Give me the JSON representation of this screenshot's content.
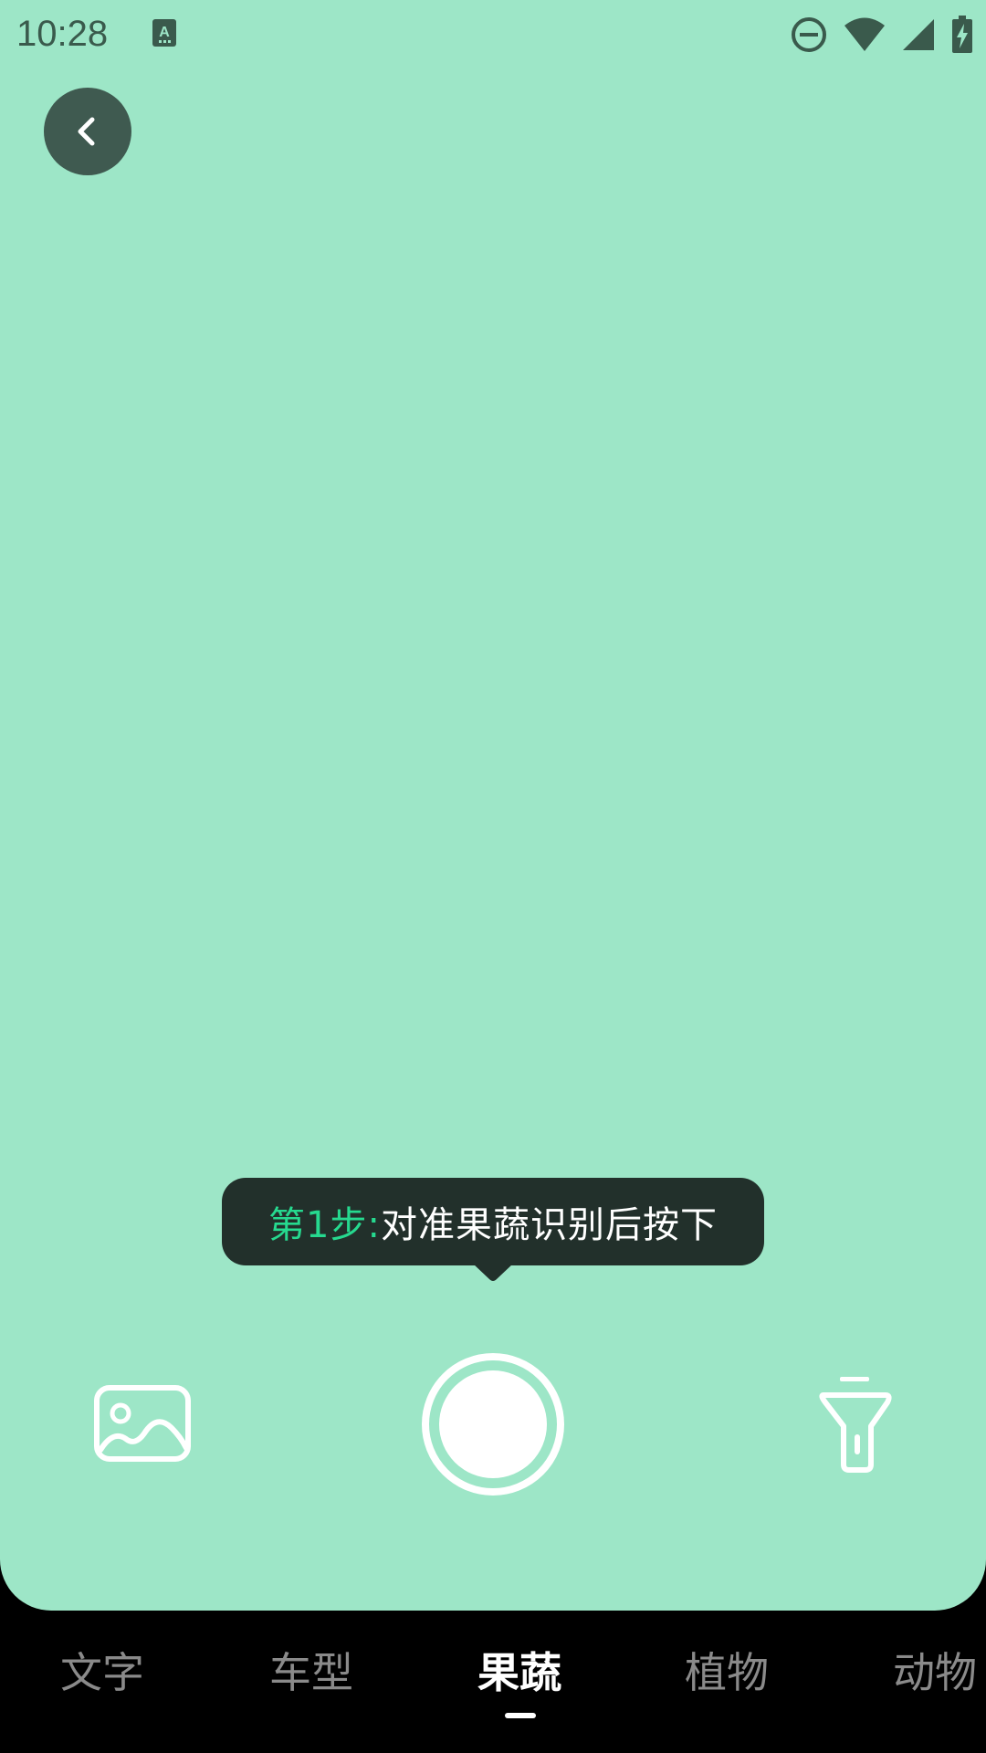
{
  "status_bar": {
    "time": "10:28",
    "icons": [
      "keyboard-a-icon",
      "do-not-disturb-icon",
      "wifi-icon",
      "cell-signal-icon",
      "battery-charging-icon"
    ]
  },
  "camera": {
    "background_color": "#9de6c7",
    "back_icon": "chevron-left-icon"
  },
  "tip": {
    "step": "第1步:",
    "text": "对准果蔬识别后按下",
    "step_color": "#26d98f"
  },
  "controls": {
    "gallery_icon": "image-icon",
    "shutter_icon": "shutter-icon",
    "flash_icon": "flashlight-icon"
  },
  "tabs": [
    {
      "label": "文字",
      "active": false
    },
    {
      "label": "车型",
      "active": false
    },
    {
      "label": "果蔬",
      "active": true
    },
    {
      "label": "植物",
      "active": false
    },
    {
      "label": "动物",
      "active": false
    }
  ]
}
